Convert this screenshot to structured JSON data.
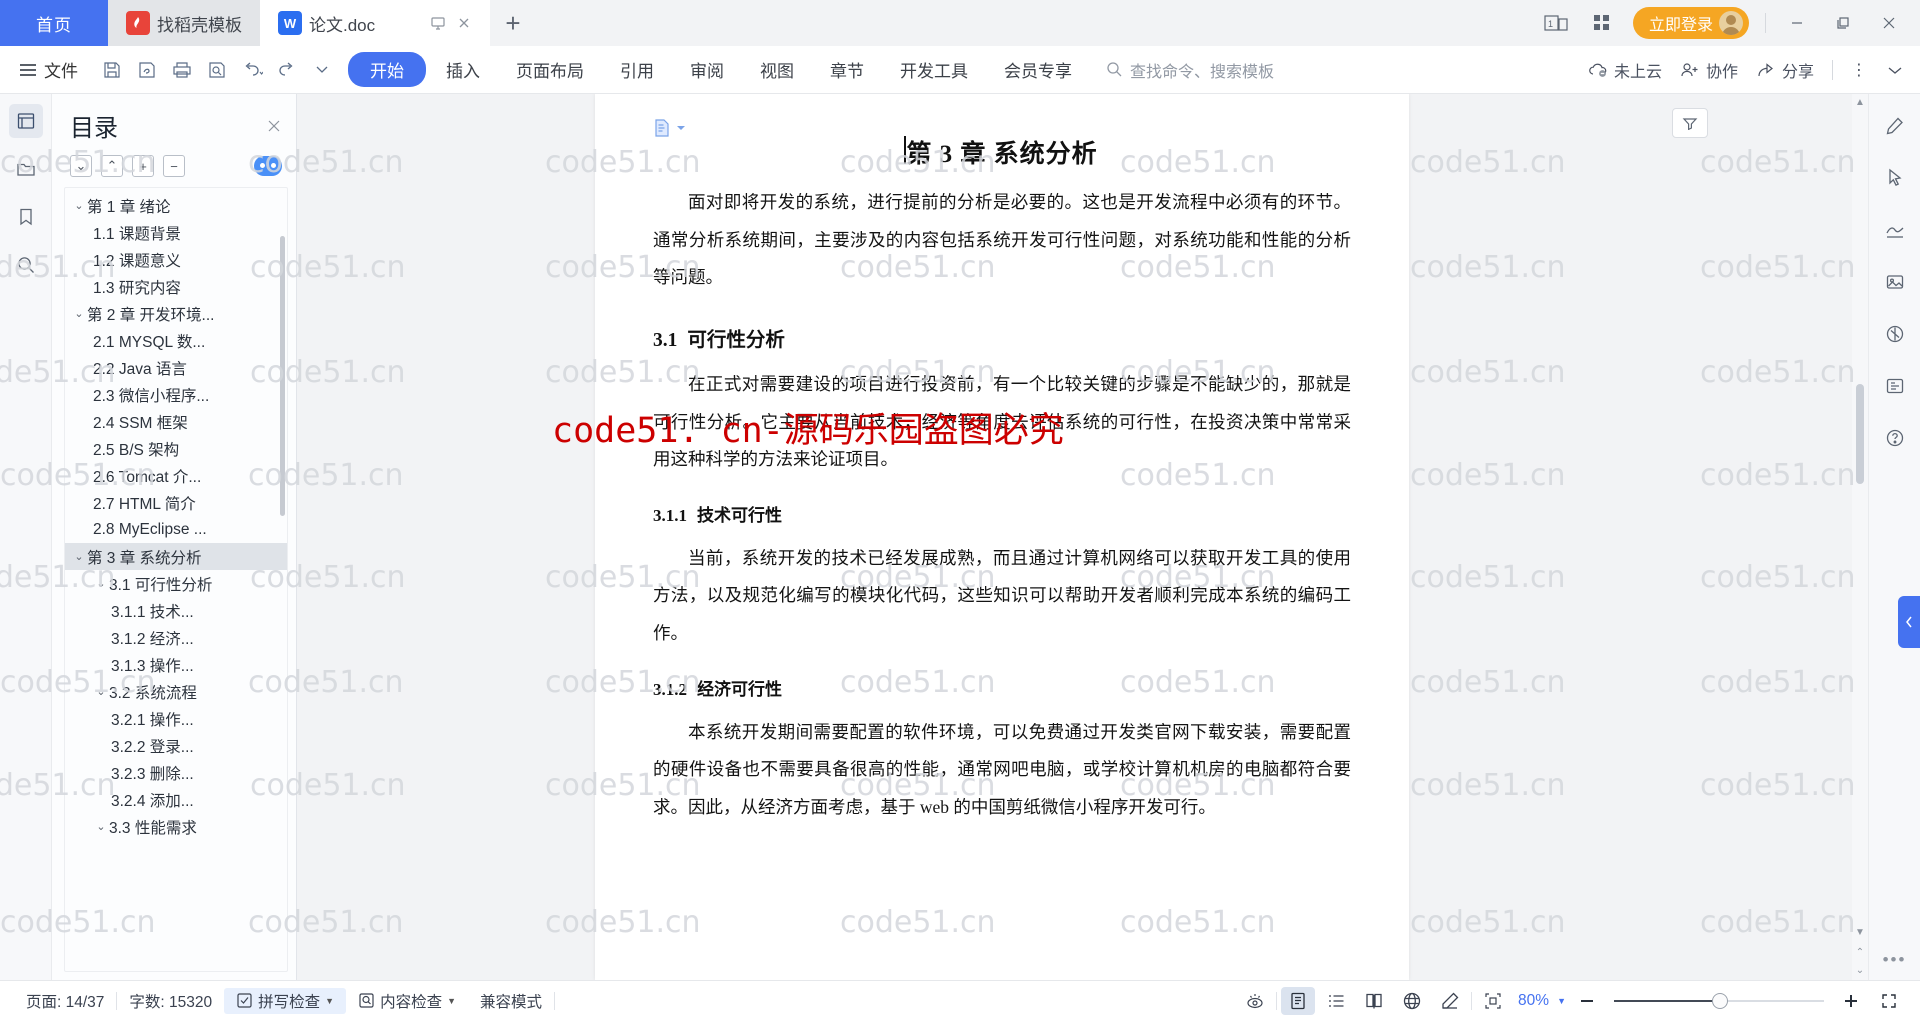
{
  "titlebar": {
    "home_tab": "首页",
    "tabs": [
      {
        "label": "找稻壳模板",
        "icon": "docer-icon",
        "mark": "稻"
      },
      {
        "label": "论文.doc",
        "icon": "wps-writer-icon",
        "mark": "W"
      }
    ],
    "new_tab": "+",
    "login_button": "立即登录",
    "window": {
      "minimize": "—",
      "maximize": "❐",
      "close": "✕"
    },
    "page_count_icon": "1",
    "grid_icon": "grid-icon"
  },
  "ribbon": {
    "file_menu": "文件",
    "quick_access": [
      "save-icon",
      "save-as-icon",
      "print-icon",
      "print-preview-icon",
      "undo-icon",
      "redo-icon",
      "customize-icon"
    ],
    "tabs": [
      {
        "label": "开始",
        "selected": true
      },
      {
        "label": "插入",
        "selected": false
      },
      {
        "label": "页面布局",
        "selected": false
      },
      {
        "label": "引用",
        "selected": false
      },
      {
        "label": "审阅",
        "selected": false
      },
      {
        "label": "视图",
        "selected": false
      },
      {
        "label": "章节",
        "selected": false
      },
      {
        "label": "开发工具",
        "selected": false
      },
      {
        "label": "会员专享",
        "selected": false
      }
    ],
    "search_placeholder": "查找命令、搜索模板",
    "right_items": [
      {
        "label": "未上云",
        "icon": "cloud-off-icon"
      },
      {
        "label": "协作",
        "icon": "collaborate-icon"
      },
      {
        "label": "分享",
        "icon": "share-icon"
      }
    ],
    "more": "⋮",
    "collapse_ribbon": "chevron-down-icon"
  },
  "left_rail": [
    {
      "name": "outline-icon",
      "active": true
    },
    {
      "name": "file-tree-icon",
      "active": false
    },
    {
      "name": "bookmark-icon",
      "active": false
    },
    {
      "name": "search-icon",
      "active": false
    }
  ],
  "toc": {
    "title": "目录",
    "close": "✕",
    "tools": [
      "expand-down-icon",
      "collapse-up-icon",
      "plus-icon",
      "minus-icon"
    ],
    "eye_toggle": "eye-toggle-icon",
    "items": [
      {
        "label": "第 1 章 绪论",
        "level": 1,
        "caret": "⌄",
        "selected": false
      },
      {
        "label": "1.1 课题背景",
        "level": 2,
        "caret": "",
        "selected": false
      },
      {
        "label": "1.2 课题意义",
        "level": 2,
        "caret": "",
        "selected": false
      },
      {
        "label": "1.3 研究内容",
        "level": 2,
        "caret": "",
        "selected": false
      },
      {
        "label": "第 2 章 开发环境...",
        "level": 1,
        "caret": "⌄",
        "selected": false
      },
      {
        "label": "2.1 MYSQL 数...",
        "level": 2,
        "caret": "",
        "selected": false
      },
      {
        "label": "2.2 Java 语言",
        "level": 2,
        "caret": "",
        "selected": false
      },
      {
        "label": "2.3 微信小程序...",
        "level": 2,
        "caret": "",
        "selected": false
      },
      {
        "label": "2.4 SSM 框架",
        "level": 2,
        "caret": "",
        "selected": false
      },
      {
        "label": "2.5 B/S 架构",
        "level": 2,
        "caret": "",
        "selected": false
      },
      {
        "label": "2.6 Tomcat 介...",
        "level": 2,
        "caret": "",
        "selected": false
      },
      {
        "label": "2.7 HTML 简介",
        "level": 2,
        "caret": "",
        "selected": false
      },
      {
        "label": "2.8 MyEclipse ...",
        "level": 2,
        "caret": "",
        "selected": false
      },
      {
        "label": "第 3 章 系统分析",
        "level": 1,
        "caret": "⌄",
        "selected": true
      },
      {
        "label": "3.1 可行性分析",
        "level": 2,
        "caret": "⌄",
        "selected": false
      },
      {
        "label": "3.1.1 技术...",
        "level": 3,
        "caret": "",
        "selected": false
      },
      {
        "label": "3.1.2 经济...",
        "level": 3,
        "caret": "",
        "selected": false
      },
      {
        "label": "3.1.3 操作...",
        "level": 3,
        "caret": "",
        "selected": false
      },
      {
        "label": "3.2 系统流程",
        "level": 2,
        "caret": "⌄",
        "selected": false
      },
      {
        "label": "3.2.1 操作...",
        "level": 3,
        "caret": "",
        "selected": false
      },
      {
        "label": "3.2.2 登录...",
        "level": 3,
        "caret": "",
        "selected": false
      },
      {
        "label": "3.2.3 删除...",
        "level": 3,
        "caret": "",
        "selected": false
      },
      {
        "label": "3.2.4 添加...",
        "level": 3,
        "caret": "",
        "selected": false
      },
      {
        "label": "3.3 性能需求",
        "level": 2,
        "caret": "⌄",
        "selected": false
      }
    ]
  },
  "document": {
    "heading1": "第 3 章 系统分析",
    "paragraphs": [
      {
        "type": "p",
        "text": "面对即将开发的系统，进行提前的分析是必要的。这也是开发流程中必须有的环节。通常分析系统期间，主要涉及的内容包括系统开发可行性问题，对系统功能和性能的分析等问题。"
      },
      {
        "type": "h2",
        "num": "3.1",
        "text": "可行性分析"
      },
      {
        "type": "p",
        "text": "在正式对需要建设的项目进行投资前，有一个比较关键的步骤是不能缺少的，那就是可行性分析。它主要从当前技术，经济等角度去评估系统的可行性，在投资决策中常常采用这种科学的方法来论证项目。"
      },
      {
        "type": "h3",
        "num": "3.1.1",
        "text": "技术可行性"
      },
      {
        "type": "p",
        "text": "当前，系统开发的技术已经发展成熟，而且通过计算机网络可以获取开发工具的使用方法，以及规范化编写的模块化代码，这些知识可以帮助开发者顺利完成本系统的编码工作。"
      },
      {
        "type": "h3",
        "num": "3.1.2",
        "text": "经济可行性"
      },
      {
        "type": "p",
        "text": "本系统开发期间需要配置的软件环境，可以免费通过开发类官网下载安装，需要配置的硬件设备也不需要具备很高的性能，通常网吧电脑，或学校计算机机房的电脑都符合要求。因此，从经济方面考虑，基于 web 的中国剪纸微信小程序开发可行。"
      }
    ],
    "watermark_text": "code51.cn",
    "watermark_banner": "code51. cn-源码乐园盗图必究",
    "watermark_banner_color": "#cc0000"
  },
  "right_rail": [
    {
      "name": "pen-edit-icon"
    },
    {
      "name": "cursor-select-icon"
    },
    {
      "name": "signature-icon"
    },
    {
      "name": "image-tool-icon"
    },
    {
      "name": "shield-check-icon"
    },
    {
      "name": "doc-scan-icon"
    },
    {
      "name": "help-icon"
    }
  ],
  "right_rail_more": "•••",
  "status": {
    "page": "页面: 14/37",
    "words": "字数: 15320",
    "spell_check": "拼写检查",
    "content_check": "内容检查",
    "compat_mode": "兼容模式",
    "view_buttons": [
      {
        "name": "focus-mode-icon",
        "selected": false
      },
      {
        "name": "page-view-icon",
        "selected": true
      },
      {
        "name": "outline-view-icon",
        "selected": false
      },
      {
        "name": "reading-view-icon",
        "selected": false
      },
      {
        "name": "web-view-icon",
        "selected": false
      },
      {
        "name": "markup-view-icon",
        "selected": false
      }
    ],
    "fit_icon": "fit-page-icon",
    "zoom": "80%",
    "zoom_out": "−",
    "zoom_in": "+",
    "fullscreen": "fullscreen-icon"
  },
  "colors": {
    "accent": "#4572f0",
    "login": "#f5a623",
    "watermark": "#d4d7dc",
    "red_banner": "#cc0000"
  }
}
